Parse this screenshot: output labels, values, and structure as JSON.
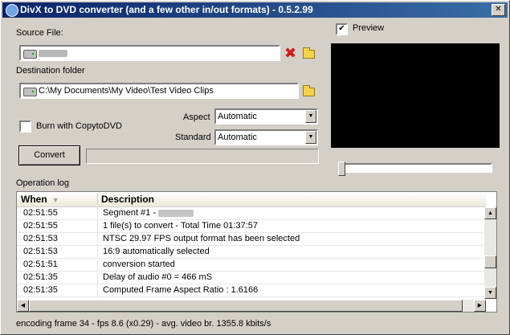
{
  "window": {
    "title": "DivX to DVD converter (and a few other in/out formats) - 0.5.2.99",
    "close_label": "✕"
  },
  "source": {
    "label": "Source File:"
  },
  "destination": {
    "label": "Destination folder",
    "value": "C:\\My Documents\\My Video\\Test Video Clips"
  },
  "options": {
    "burn_label": "Burn with CopytoDVD",
    "burn_checked": false,
    "aspect_label": "Aspect",
    "aspect_value": "Automatic",
    "standard_label": "Standard",
    "standard_value": "Automatic"
  },
  "actions": {
    "convert_label": "Convert"
  },
  "preview": {
    "label": "Preview",
    "checked": true,
    "check_mark": "✔"
  },
  "log": {
    "title": "Operation log",
    "columns": {
      "when": "When",
      "description": "Description"
    },
    "rows": [
      {
        "when": "02:51:55",
        "description": "Segment #1 - "
      },
      {
        "when": "02:51:55",
        "description": "1 file(s) to convert - Total Time 01:37:57"
      },
      {
        "when": "02:51:53",
        "description": "NTSC 29.97 FPS output format has been selected"
      },
      {
        "when": "02:51:53",
        "description": "16:9 automatically selected"
      },
      {
        "when": "02:51:51",
        "description": "conversion started"
      },
      {
        "when": "02:51:35",
        "description": "Delay of audio #0 = 466 mS"
      },
      {
        "when": "02:51:35",
        "description": "Computed Frame Aspect Ratio : 1.6166"
      }
    ]
  },
  "status": {
    "text": "encoding frame 34 - fps 8.6 (x0.29) - avg. video br. 1355.8 kbits/s"
  },
  "icons": {
    "sort_arrow": "▼",
    "scroll_up": "▲",
    "scroll_down": "▼",
    "scroll_left": "◀",
    "scroll_right": "▶",
    "combo_arrow": "▼",
    "clear": "✖"
  }
}
